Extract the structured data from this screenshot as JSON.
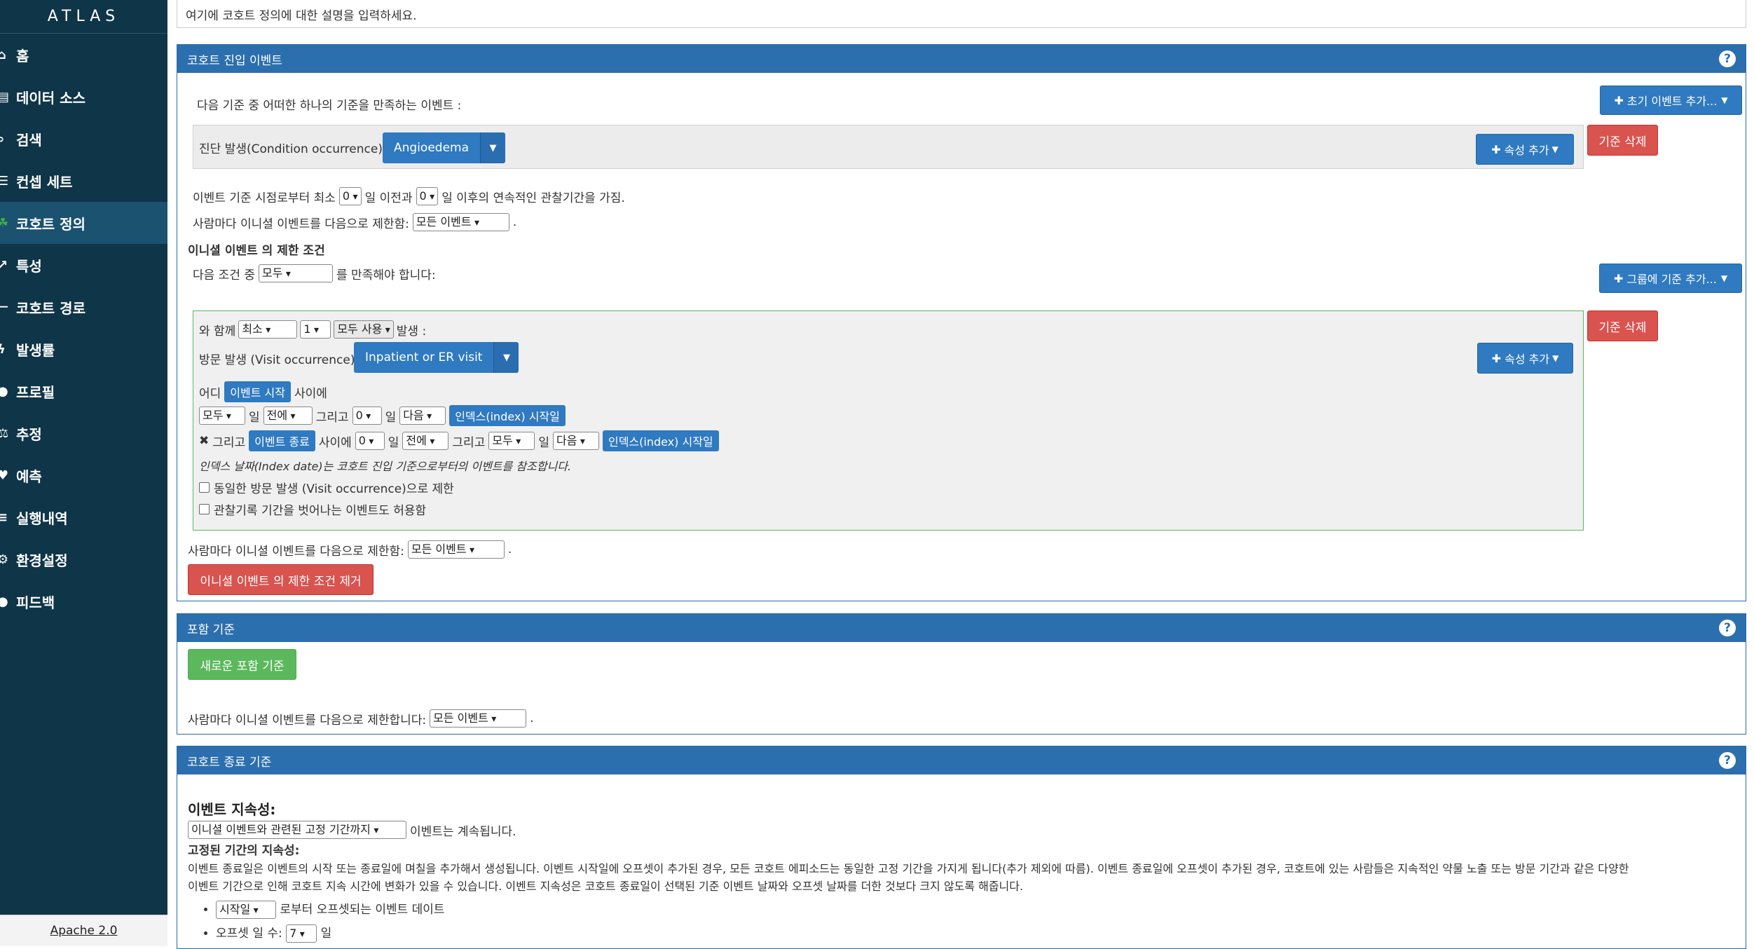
{
  "app": {
    "logo": "ATLAS",
    "license": "Apache 2.0"
  },
  "nav": [
    {
      "label": "홈",
      "icon": "home-icon",
      "glyph": "⌂"
    },
    {
      "label": "데이터 소스",
      "icon": "database-icon",
      "glyph": "▤"
    },
    {
      "label": "검색",
      "icon": "search-icon",
      "glyph": "⌕"
    },
    {
      "label": "컨셉 세트",
      "icon": "list-icon",
      "glyph": "☰"
    },
    {
      "label": "코호트 정의",
      "icon": "users-icon",
      "glyph": "☘"
    },
    {
      "label": "특성",
      "icon": "chart-line-icon",
      "glyph": "↗"
    },
    {
      "label": "코호트 경로",
      "icon": "sitemap-icon",
      "glyph": "⊢"
    },
    {
      "label": "발생률",
      "icon": "bolt-icon",
      "glyph": "ϟ"
    },
    {
      "label": "프로필",
      "icon": "user-icon",
      "glyph": "●"
    },
    {
      "label": "추정",
      "icon": "balance-icon",
      "glyph": "⚖"
    },
    {
      "label": "예측",
      "icon": "heartbeat-icon",
      "glyph": "♥"
    },
    {
      "label": "실행내역",
      "icon": "history-icon",
      "glyph": "≡"
    },
    {
      "label": "환경설정",
      "icon": "cogs-icon",
      "glyph": "⚙"
    },
    {
      "label": "피드백",
      "icon": "comment-icon",
      "glyph": "●"
    }
  ],
  "active_nav_index": 4,
  "description_placeholder": "여기에 코호트 정의에 대한 설명을 입력하세요.",
  "entry": {
    "title": "코호트 진입 이벤트",
    "intro": "다음 기준 중 어떠한 하나의 기준을 만족하는 이벤트 :",
    "add_initial_event_button": "초기 이벤트 추가...",
    "criterion_label": "진단 발생(Condition occurrence)",
    "criterion_concept": "Angioedema",
    "add_attribute_button": "속성 추가",
    "delete_criterion_button": "기준 삭제",
    "observation_prefix": "이벤트 기준 시점로부터 최소",
    "observation_before_value": "0",
    "observation_mid": "일 이전과",
    "observation_after_value": "0",
    "observation_suffix": "일 이후의 연속적인 관찰기간을 가짐.",
    "limit_label": "사람마다 이니셜 이벤트를 다음으로 제한함:",
    "limit_value": "모든 이벤트",
    "restriction_title": "이니셜 이벤트 의 제한 조건",
    "restriction_prefix": "다음 조건 중",
    "restriction_value": "모두",
    "restriction_suffix": "를 만족해야 합니다:",
    "add_group_criteria_button": "그룹에 기준 추가...",
    "group": {
      "with_label": "와 함께",
      "occ_type": "최소",
      "occ_count": "1",
      "use_all_button": "모두 사용",
      "occ_suffix": "발생 :",
      "criterion_label": "방문 발생 (Visit occurrence)",
      "criterion_concept": "Inpatient or ER visit",
      "add_attribute_button": "속성 추가",
      "delete_criterion_button": "기준 삭제",
      "where_label": "어디",
      "event_start_tag": "이벤트 시작",
      "between_label": "사이에",
      "row1": {
        "all": "모두",
        "day": "일",
        "dir1": "전에",
        "and": "그리고",
        "n2": "0",
        "day2": "일",
        "dir2": "다음",
        "index_tag": "인덱스(index) 시작일"
      },
      "row2": {
        "remove_glyph": "✖",
        "and": "그리고",
        "event_end_tag": "이벤트 종료",
        "between": "사이에",
        "n1": "0",
        "day": "일",
        "dir1": "전에",
        "and2": "그리고",
        "all": "모두",
        "day2": "일",
        "dir2": "다음",
        "index_tag": "인덱스(index) 시작일"
      },
      "index_note": "인덱스 날짜(Index date)는 코호트 진입 기준으로부터의 이벤트를 참조합니다.",
      "checkbox1": "동일한 방문 발생 (Visit occurrence)으로 제한",
      "checkbox2": "관찰기록 기간을 벗어나는 이벤트도 허용함"
    },
    "limit2_label": "사람마다 이니셜 이벤트를 다음으로 제한함:",
    "limit2_value": "모든 이벤트",
    "remove_restriction_button": "이니셜 이벤트 의 제한 조건 제거"
  },
  "inclusion": {
    "title": "포함 기준",
    "new_button": "새로운 포함 기준",
    "limit_label": "사람마다 이니셜 이벤트를 다음으로 제한합니다:",
    "limit_value": "모든 이벤트"
  },
  "exit": {
    "title": "코호트 종료 기준",
    "persistence_title": "이벤트 지속성:",
    "persistence_value": "이니셜 이벤트와 관련된 고정 기간까지",
    "persistence_suffix": "이벤트는 계속됩니다.",
    "fixed_title": "고정된 기간의 지속성:",
    "fixed_desc_line1": "이벤트 종료일은 이벤트의 시작 또는 종료일에 며칠을 추가해서 생성됩니다. 이벤트 시작일에 오프셋이 추가된 경우, 모든 코호트 에피소드는 동일한 고정 기간을 가지게 됩니다(추가 제외에 따름). 이벤트 종료일에 오프셋이 추가된 경우, 코호트에 있는 사람들은 지속적인 약물 노출 또는 방문 기간과 같은 다양한",
    "fixed_desc_line2": "이벤트 기간으로 인해 코호트 지속 시간에 변화가 있을 수 있습니다. 이벤트 지속성은 코호트 종료일이 선택된 기준 이벤트 날짜와 오프셋 날짜를 더한 것보다 크지 않도록 해줍니다.",
    "offset_from_value": "시작일",
    "offset_from_suffix": "로부터 오프셋되는 이벤트 데이트",
    "offset_days_label": "오프셋 일 수:",
    "offset_days_value": "7",
    "offset_days_suffix": "일"
  }
}
